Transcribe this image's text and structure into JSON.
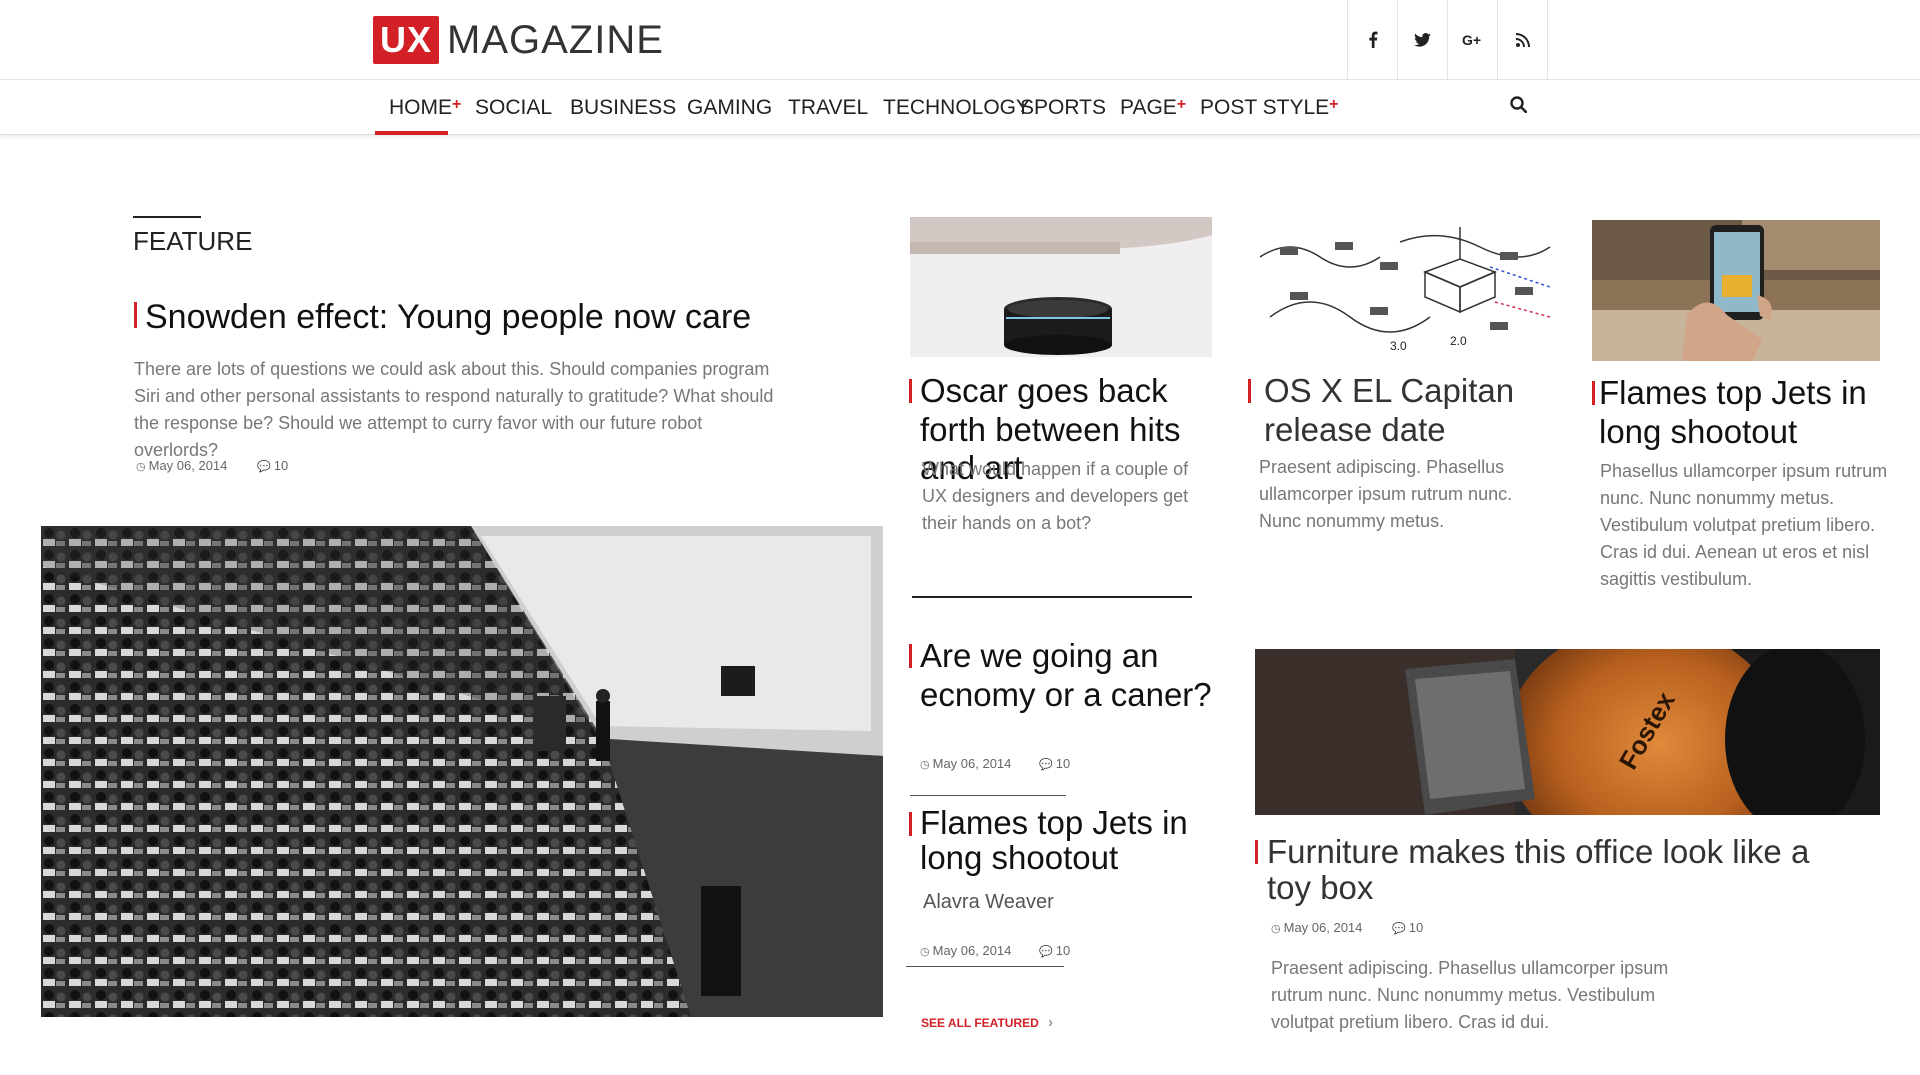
{
  "header": {
    "logo_mark": "UX",
    "logo_text": "MAGAZINE",
    "social": [
      {
        "icon": "facebook-icon",
        "glyph": "f"
      },
      {
        "icon": "twitter-icon",
        "glyph": "t"
      },
      {
        "icon": "google-plus-icon",
        "glyph": "G+"
      },
      {
        "icon": "rss-icon",
        "glyph": "rss"
      }
    ]
  },
  "nav": {
    "items": [
      {
        "label": "HOME",
        "plus": "+"
      },
      {
        "label": "SOCIAL"
      },
      {
        "label": "BUSINESS"
      },
      {
        "label": "GAMING"
      },
      {
        "label": "TRAVEL"
      },
      {
        "label": "TECHNOLOGY"
      },
      {
        "label": "SPORTS"
      },
      {
        "label": "PAGE",
        "plus": "+"
      },
      {
        "label": "POST STYLE",
        "plus": "+"
      }
    ],
    "search_icon": "search-icon"
  },
  "feature": {
    "section_label": "FEATURE",
    "title": "Snowden effect: Young people now care",
    "excerpt": "There are lots of questions we could ask about this. Should companies program Siri and other personal assistants to respond naturally to gratitude? What should the response be? Should we attempt to curry favor with our future robot overlords?",
    "date": "May 06, 2014",
    "comments": "10"
  },
  "cards": [
    {
      "title": "Oscar goes back forth between hits and art",
      "excerpt": "What would happen if a couple of UX designers and developers get their hands on a bot?"
    },
    {
      "title": "OS X EL Capitan release date",
      "excerpt": "Praesent adipiscing. Phasellus ullamcorper ipsum rutrum nunc. Nunc nonummy metus."
    },
    {
      "title": "Flames top Jets in long shootout",
      "excerpt": "Phasellus ullamcorper ipsum rutrum nunc. Nunc nonummy metus. Vestibulum volutpat pretium libero. Cras id dui. Aenean ut eros et nisl sagittis vestibulum."
    }
  ],
  "list": [
    {
      "title": "Are we going an ecnomy or a caner?",
      "date": "May 06, 2014",
      "comments": "10"
    },
    {
      "title": "Flames top Jets in long shootout",
      "author": "Alavra Weaver",
      "date": "May 06, 2014",
      "comments": "10"
    }
  ],
  "see_all": "SEE ALL FEATURED",
  "big_card": {
    "title": "Furniture makes this office look like a toy box",
    "date": "May 06, 2014",
    "comments": "10",
    "excerpt": "Praesent adipiscing. Phasellus ullamcorper ipsum rutrum nunc. Nunc nonummy metus. Vestibulum volutpat pretium libero. Cras id dui."
  },
  "colors": {
    "accent": "#d32027",
    "text": "#222222",
    "muted": "#777777"
  }
}
